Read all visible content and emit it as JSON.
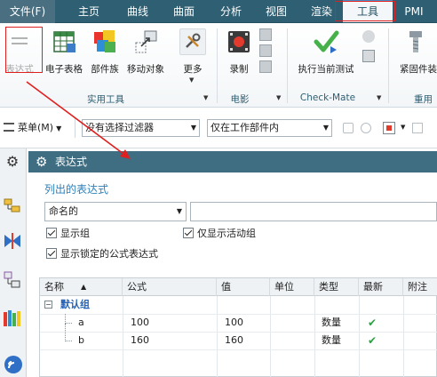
{
  "menubar": {
    "items": [
      "文件(F)",
      "主页",
      "曲线",
      "曲面",
      "分析",
      "视图",
      "渲染",
      "工具",
      "PMI"
    ],
    "active": "工具"
  },
  "ribbon": {
    "buttons": [
      {
        "label": "表达式",
        "icon": "expression-icon",
        "disabled": true
      },
      {
        "label": "电子表格",
        "icon": "spreadsheet-icon"
      },
      {
        "label": "部件族",
        "icon": "part-family-icon"
      },
      {
        "label": "移动对象",
        "icon": "move-object-icon"
      },
      {
        "label": "更多",
        "icon": "more-tools-icon"
      },
      {
        "label": "录制",
        "icon": "record-icon"
      },
      {
        "label": "执行当前测试",
        "icon": "run-test-icon"
      },
      {
        "label": "紧固件装",
        "icon": "fastener-icon"
      }
    ],
    "groups": [
      "实用工具",
      "电影",
      "Check-Mate",
      "重用"
    ]
  },
  "selection_bar": {
    "menu_label": "菜单(M)",
    "filter": "没有选择过滤器",
    "scope": "仅在工作部件内"
  },
  "panel": {
    "title": "表达式",
    "subtitle": "列出的表达式",
    "filter_combo": "命名的",
    "checkboxes": {
      "show_groups": "显示组",
      "show_active_group_only": "仅显示活动组",
      "show_locked_formula": "显示锁定的公式表达式"
    }
  },
  "table": {
    "columns": [
      "名称",
      "公式",
      "值",
      "单位",
      "类型",
      "最新",
      "附注"
    ],
    "group_name": "默认组",
    "rows": [
      {
        "name": "a",
        "formula": "100",
        "value": "100",
        "unit": "",
        "type": "数量",
        "uptodate": "✔",
        "note": ""
      },
      {
        "name": "b",
        "formula": "160",
        "value": "160",
        "unit": "",
        "type": "数量",
        "uptodate": "✔",
        "note": ""
      }
    ]
  },
  "colors": {
    "menubar": "#2e5f73",
    "panel_header": "#3f6d82",
    "annotation_red": "#e02020",
    "accent_blue": "#2e7fb8"
  }
}
